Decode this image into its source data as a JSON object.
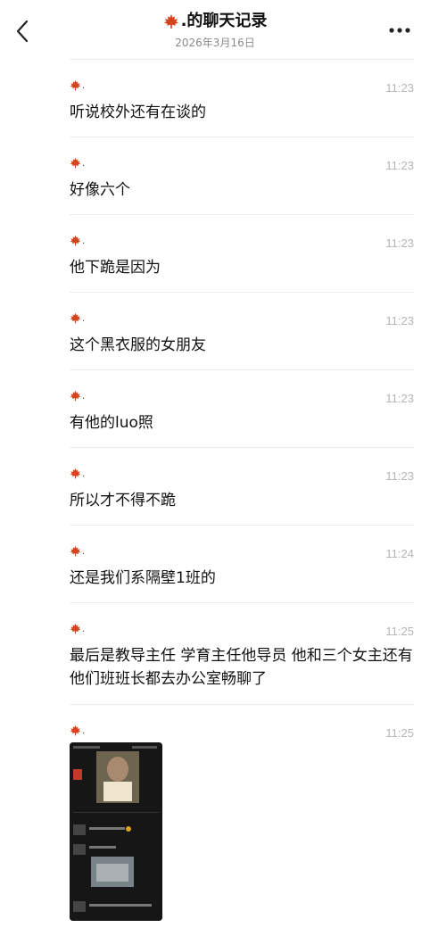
{
  "header": {
    "title": ".的聊天记录",
    "date": "2026年3月16日",
    "back_icon": "chevron-left-icon",
    "more_icon": "more-dots-icon"
  },
  "sender": {
    "name": ".",
    "avatar_icon": "maple-leaf-icon",
    "leaf_color": "#d4451f"
  },
  "messages": [
    {
      "time": "11:23",
      "text": "听说校外还有在谈的"
    },
    {
      "time": "11:23",
      "text": "好像六个"
    },
    {
      "time": "11:23",
      "text": "他下跪是因为"
    },
    {
      "time": "11:23",
      "text": "这个黑衣服的女朋友"
    },
    {
      "time": "11:23",
      "text": "有他的luo照"
    },
    {
      "time": "11:23",
      "text": "所以才不得不跪"
    },
    {
      "time": "11:24",
      "text": "还是我们系隔壁1班的"
    },
    {
      "time": "11:25",
      "text": "最后是教导主任 学育主任他导员 他和三个女主还有他们班班长都去办公室畅聊了"
    },
    {
      "time": "11:25",
      "image": "chat-screenshot-thumbnail"
    }
  ]
}
